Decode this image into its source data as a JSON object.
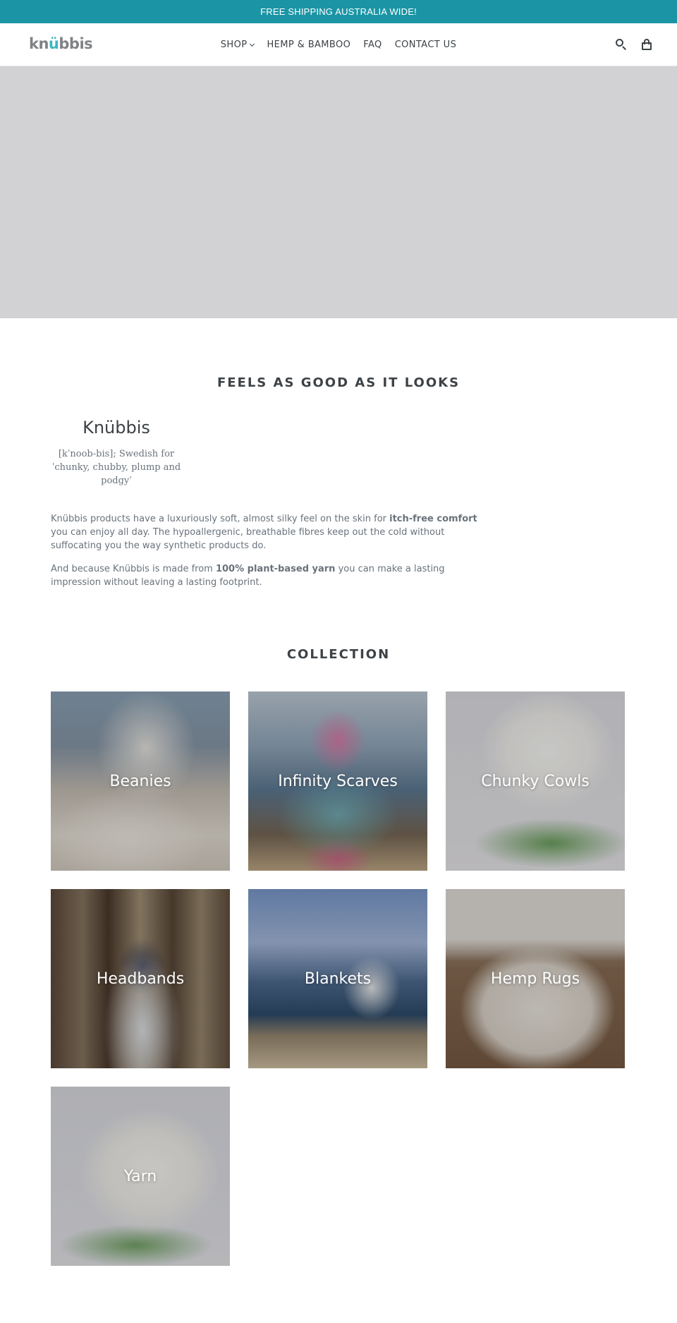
{
  "announcement": {
    "text": "FREE SHIPPING AUSTRALIA WIDE!"
  },
  "header": {
    "logo": {
      "part1": "kn",
      "part2": "ü",
      "part3": "bbis"
    },
    "nav": [
      {
        "label": "SHOP",
        "has_dropdown": true
      },
      {
        "label": "HEMP & BAMBOO",
        "has_dropdown": false
      },
      {
        "label": "FAQ",
        "has_dropdown": false
      },
      {
        "label": "CONTACT US",
        "has_dropdown": false
      }
    ],
    "icons": [
      "search-icon",
      "cart-icon"
    ]
  },
  "intro": {
    "title": "FEELS AS GOOD AS IT LOOKS",
    "brand_name": "Knübbis",
    "brand_definition": "[kˈnoob-bis]; Swedish for ˈchunky, chubby, plump and podgyˈ",
    "para1_pre": "Knübbis products have a luxuriously soft, almost silky feel on the skin for ",
    "para1_bold": "itch-free comfort",
    "para1_post": " you can enjoy all day. The hypoallergenic, breathable fibres keep out the cold without suffocating you the way synthetic products do.",
    "para2_pre": "And because Knübbis is made from ",
    "para2_bold": "100% plant-based yarn",
    "para2_post": " you can make a lasting impression without leaving a lasting footprint."
  },
  "collection": {
    "title": "COLLECTION",
    "items": [
      {
        "label": "Beanies"
      },
      {
        "label": "Infinity Scarves"
      },
      {
        "label": "Chunky Cowls"
      },
      {
        "label": "Headbands"
      },
      {
        "label": "Blankets"
      },
      {
        "label": "Hemp Rugs"
      },
      {
        "label": "Yarn"
      }
    ]
  },
  "colors": {
    "announcement_bg": "#1b95a5",
    "logo_accent": "#3bb8c4",
    "logo_gray": "#808285",
    "text": "#3d4246",
    "muted_text": "#69727b",
    "hero_placeholder": "#d2d1d3"
  }
}
